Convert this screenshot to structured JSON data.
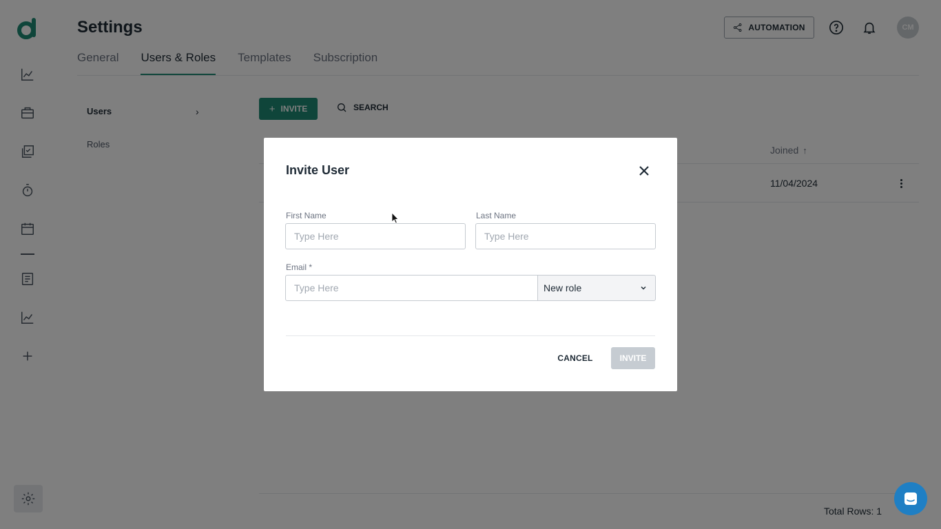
{
  "app": {
    "brand_letter": "d",
    "brand_color": "#1f8a74"
  },
  "header": {
    "title": "Settings",
    "tabs": [
      {
        "label": "General",
        "active": false
      },
      {
        "label": "Users & Roles",
        "active": true
      },
      {
        "label": "Templates",
        "active": false
      },
      {
        "label": "Subscription",
        "active": false
      }
    ],
    "automation_label": "AUTOMATION",
    "avatar_initials": "CM"
  },
  "sidebar": {
    "icons": [
      "chart-line-icon",
      "briefcase-icon",
      "checklist-icon",
      "stopwatch-icon",
      "calendar-icon",
      "document-icon",
      "chart-line-icon",
      "plus-icon"
    ],
    "settings_icon": "gear-icon"
  },
  "subnav": {
    "users": "Users",
    "roles": "Roles"
  },
  "toolbar": {
    "invite_label": "INVITE",
    "search_label": "SEARCH"
  },
  "table": {
    "columns": [
      "Joined"
    ],
    "rows": [
      {
        "joined": "11/04/2024"
      }
    ],
    "total_rows_text": "Total Rows: 1"
  },
  "modal": {
    "title": "Invite User",
    "first_name_label": "First Name",
    "first_name_placeholder": "Type Here",
    "last_name_label": "Last Name",
    "last_name_placeholder": "Type Here",
    "email_label": "Email *",
    "email_placeholder": "Type Here",
    "role_value": "New role",
    "cancel_label": "CANCEL",
    "invite_label": "INVITE"
  },
  "colors": {
    "accent": "#1f8a74",
    "chat": "#1f7fc4",
    "disabled": "#c6ccd2"
  }
}
